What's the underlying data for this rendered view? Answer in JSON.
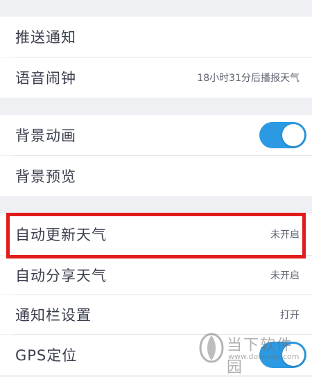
{
  "settings": {
    "rows": [
      {
        "label": "推送通知"
      },
      {
        "label": "语音闹钟",
        "value": "18小时31分后播报天气"
      },
      {
        "label": "背景动画",
        "toggle": true
      },
      {
        "label": "背景预览"
      },
      {
        "label": "自动更新天气",
        "value": "未开启"
      },
      {
        "label": "自动分享天气",
        "value": "未开启"
      },
      {
        "label": "通知栏设置",
        "value": "打开"
      },
      {
        "label": "GPS定位",
        "toggle": true
      }
    ]
  },
  "colors": {
    "toggle_on": "#2b9ae3",
    "highlight": "#e21b1b"
  },
  "watermark": {
    "title": "当下软件园",
    "url": "www.downxia.com"
  }
}
